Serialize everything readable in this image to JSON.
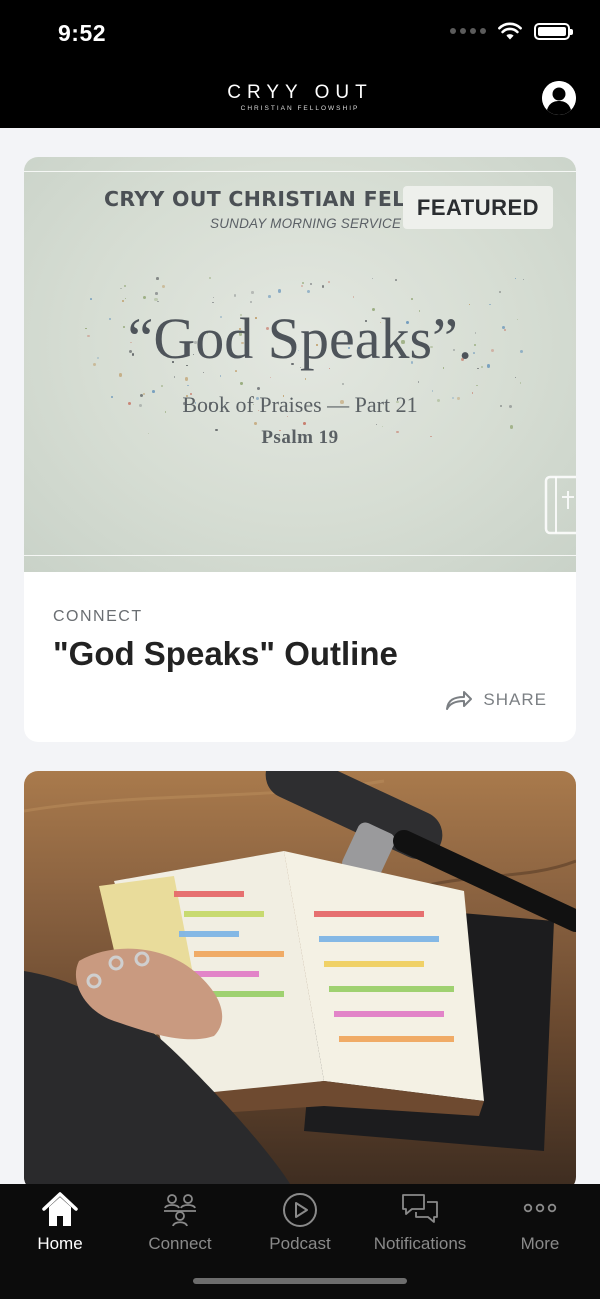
{
  "status_bar": {
    "time": "9:52"
  },
  "header": {
    "brand_name": "CRYY OUT",
    "brand_sub": "CHRISTIAN FELLOWSHIP",
    "profile_icon": "user-circle-icon"
  },
  "feed": {
    "featured": {
      "badge": "FEATURED",
      "image": {
        "org": "CRYY OUT CHRISTIAN FELLOWSHIP",
        "service": "SUNDAY MORNING SERVICE",
        "title": "“God Speaks”.",
        "subtitle": "Book of Praises — Part 21",
        "psalm": "Psalm 19"
      },
      "category": "CONNECT",
      "title": "\"God Speaks\" Outline",
      "share_label": "SHARE"
    },
    "second_card": {
      "image_icon": "bible-microphone-photo"
    }
  },
  "tabbar": {
    "tabs": [
      {
        "label": "Home",
        "icon": "home-icon",
        "active": true
      },
      {
        "label": "Connect",
        "icon": "people-icon",
        "active": false
      },
      {
        "label": "Podcast",
        "icon": "play-circle-icon",
        "active": false
      },
      {
        "label": "Notifications",
        "icon": "chat-bubbles-icon",
        "active": false
      },
      {
        "label": "More",
        "icon": "more-dots-icon",
        "active": false
      }
    ]
  },
  "colors": {
    "header_bg": "#000000",
    "tabbar_bg": "#0c0c0c",
    "page_bg": "#f3f4f7",
    "active_tab": "#ffffff",
    "inactive_tab": "#8a8a8a"
  }
}
